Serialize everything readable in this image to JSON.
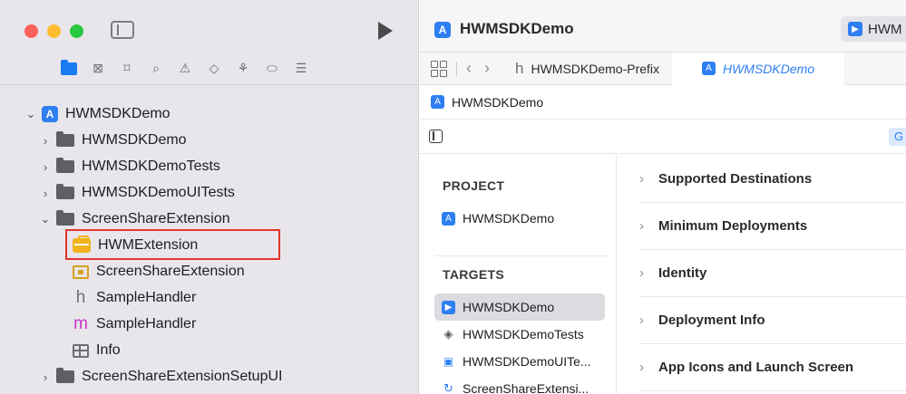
{
  "navigator": {
    "toolbar_icons": [
      "folder-icon",
      "source-control-icon",
      "bookmark-icon",
      "find-icon",
      "issue-icon",
      "test-icon",
      "debug-icon",
      "breakpoint-icon",
      "report-icon"
    ],
    "tree": [
      {
        "label": "HWMSDKDemo",
        "icon": "app-project-icon",
        "chevron": "⌄"
      },
      {
        "label": "HWMSDKDemo",
        "icon": "folder-icon",
        "chevron": "›"
      },
      {
        "label": "HWMSDKDemoTests",
        "icon": "folder-icon",
        "chevron": "›"
      },
      {
        "label": "HWMSDKDemoUITests",
        "icon": "folder-icon",
        "chevron": "›"
      },
      {
        "label": "ScreenShareExtension",
        "icon": "folder-icon",
        "chevron": "⌄"
      },
      {
        "label": "HWMExtension",
        "icon": "toolbox-icon"
      },
      {
        "label": "ScreenShareExtension",
        "icon": "app-extension-icon"
      },
      {
        "label": "SampleHandler",
        "icon": "header-file-icon",
        "glyph": "h"
      },
      {
        "label": "SampleHandler",
        "icon": "objc-file-icon",
        "glyph": "m"
      },
      {
        "label": "Info",
        "icon": "plist-icon"
      },
      {
        "label": "ScreenShareExtensionSetupUI",
        "icon": "folder-icon",
        "chevron": "›"
      }
    ]
  },
  "editor": {
    "title": "HWMSDKDemo",
    "scheme_label": "HWM",
    "tabs": {
      "prefix_tab": "HWMSDKDemo-Prefix",
      "prefix_glyph": "h",
      "active_tab": "HWMSDKDemo"
    },
    "breadcrumb": "HWMSDKDemo",
    "general_tab_label": "G",
    "project_section": "PROJECT",
    "project_item": "HWMSDKDemo",
    "targets_section": "TARGETS",
    "targets": [
      {
        "label": "HWMSDKDemo",
        "icon": "app-target-icon"
      },
      {
        "label": "HWMSDKDemoTests",
        "icon": "unit-test-icon"
      },
      {
        "label": "HWMSDKDemoUITe...",
        "icon": "ui-test-icon"
      },
      {
        "label": "ScreenShareExtensi...",
        "icon": "extension-target-icon"
      }
    ],
    "settings_sections": [
      "Supported Destinations",
      "Minimum Deployments",
      "Identity",
      "Deployment Info",
      "App Icons and Launch Screen"
    ]
  },
  "colors": {
    "accent": "#2e7ff2",
    "highlight_box": "#e2362b",
    "extension_folder": "#f2b21c",
    "objc": "#c932c8"
  }
}
